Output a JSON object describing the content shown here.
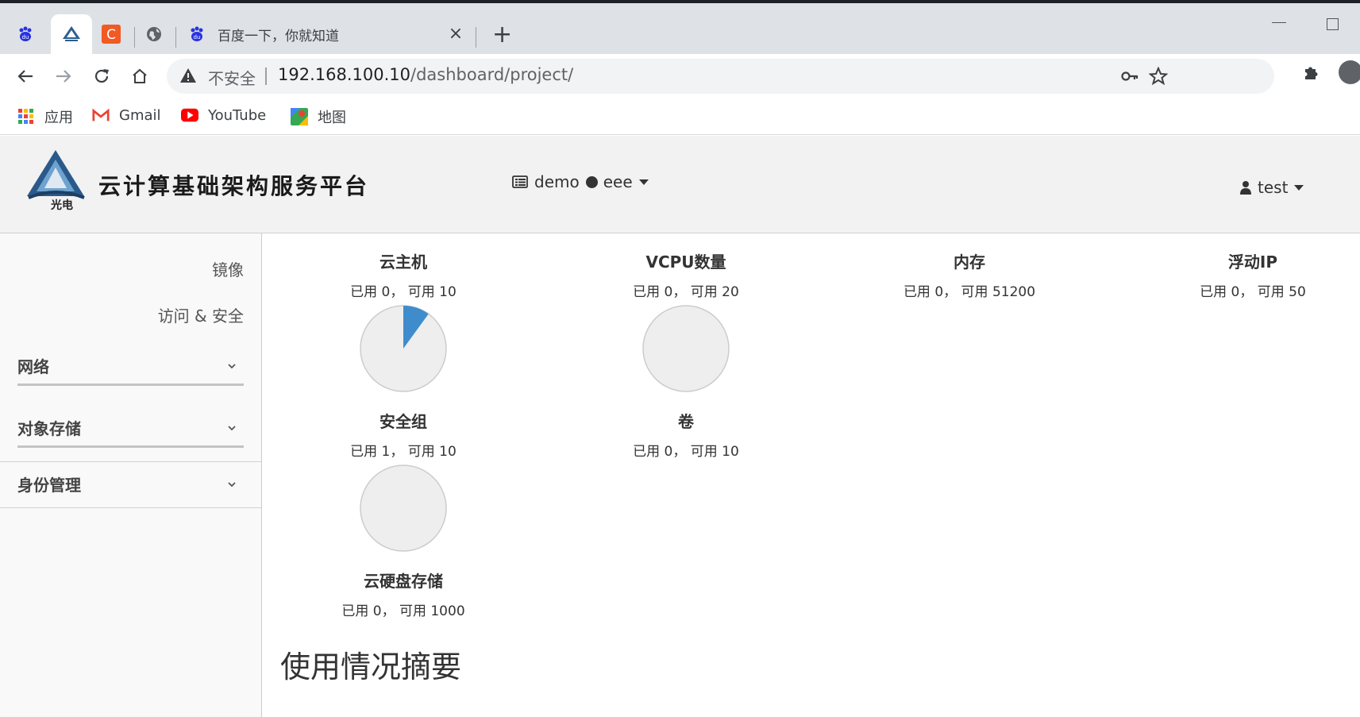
{
  "browser": {
    "tabs": [
      {
        "icon": "baidu-icon",
        "title": ""
      },
      {
        "icon": "app-logo-icon",
        "title": ""
      },
      {
        "icon": "c-logo-icon",
        "title": ""
      },
      {
        "icon": "globe-icon",
        "title": ""
      },
      {
        "icon": "baidu-icon",
        "title": "百度一下，你就知道"
      }
    ],
    "insecure_label": "不安全",
    "url_host": "192.168.100.10",
    "url_path": "/dashboard/project/",
    "bookmarks": [
      {
        "label": "应用",
        "icon": "apps-grid-icon"
      },
      {
        "label": "Gmail",
        "icon": "gmail-icon"
      },
      {
        "label": "YouTube",
        "icon": "youtube-icon"
      },
      {
        "label": "地图",
        "icon": "maps-icon"
      }
    ]
  },
  "header": {
    "brand": "云计算基础架构服务平台",
    "project": "demo",
    "domain": "eee",
    "user": "test"
  },
  "sidebar": {
    "links": [
      "镜像",
      "访问 & 安全"
    ],
    "groups": [
      "网络",
      "对象存储",
      "身份管理"
    ]
  },
  "quotas": [
    {
      "name": "云主机",
      "used_label": "已用 0， 可用 10",
      "used": 0,
      "total": 10
    },
    {
      "name": "VCPU数量",
      "used_label": "已用 0， 可用 20",
      "used": 0,
      "total": 20
    },
    {
      "name": "内存",
      "used_label": "已用 0， 可用 51200",
      "used": 0,
      "total": 51200
    },
    {
      "name": "浮动IP",
      "used_label": "已用 0， 可用 50",
      "used": 0,
      "total": 50
    },
    {
      "name": "安全组",
      "used_label": "已用 1， 可用 10",
      "used": 1,
      "total": 10
    },
    {
      "name": "卷",
      "used_label": "已用 0， 可用 10",
      "used": 0,
      "total": 10
    },
    {
      "name": "云硬盘存储",
      "used_label": "已用 0， 可用 1000",
      "used": 0,
      "total": 1000
    }
  ],
  "section_title": "使用情况摘要",
  "colors": {
    "pie_fill": "#3f8ccc",
    "pie_bg": "#eeeeee",
    "pie_stroke": "#cccccc"
  }
}
